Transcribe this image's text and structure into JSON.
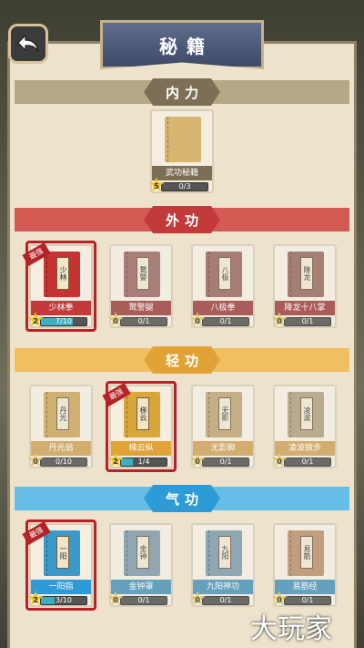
{
  "header": {
    "title": "秘籍"
  },
  "colors": {
    "neigong": "#7d6f55",
    "waigong": "#c23b3a",
    "qinggong": "#e1a236",
    "qigong": "#2e9bd6",
    "progress_fill": "#3bb0c2"
  },
  "categories": [
    {
      "label": "内力",
      "books": [
        {
          "name": "武功秘籍",
          "stars": "5",
          "progress": "0/3",
          "fill": 0.0,
          "best": false,
          "cover": "#d6b670",
          "tag": ""
        }
      ]
    },
    {
      "label": "外功",
      "books": [
        {
          "name": "少林拳",
          "stars": "2",
          "progress": "7/10",
          "fill": 0.7,
          "best": true,
          "best_label": "最强",
          "cover": "#c53431",
          "tag": "少林"
        },
        {
          "name": "鹜警腿",
          "stars": "0",
          "progress": "0/1",
          "fill": 0.0,
          "best": false,
          "cover": "#b06a62",
          "tag": "鹜警"
        },
        {
          "name": "八极拳",
          "stars": "0",
          "progress": "0/1",
          "fill": 0.0,
          "best": false,
          "cover": "#b0655c",
          "tag": "八极"
        },
        {
          "name": "降龙十八掌",
          "stars": "0",
          "progress": "0/1",
          "fill": 0.0,
          "best": false,
          "cover": "#a8695f",
          "tag": "降龙"
        }
      ]
    },
    {
      "label": "轻功",
      "books": [
        {
          "name": "丹光翁",
          "stars": "0",
          "progress": "0/10",
          "fill": 0.0,
          "best": false,
          "cover": "#d9a63a",
          "tag": "丹光"
        },
        {
          "name": "梯云纵",
          "stars": "2",
          "progress": "1/4",
          "fill": 0.25,
          "best": true,
          "best_label": "最强",
          "cover": "#d9a63a",
          "tag": "梯云"
        },
        {
          "name": "无影脚",
          "stars": "0",
          "progress": "0/1",
          "fill": 0.0,
          "best": false,
          "cover": "#c9a45e",
          "tag": "无影"
        },
        {
          "name": "凌波微步",
          "stars": "0",
          "progress": "0/1",
          "fill": 0.0,
          "best": false,
          "cover": "#b8a076",
          "tag": "凌波"
        }
      ]
    },
    {
      "label": "气功",
      "books": [
        {
          "name": "一阳指",
          "stars": "2",
          "progress": "3/10",
          "fill": 0.3,
          "best": true,
          "best_label": "最强",
          "cover": "#3a9ac9",
          "tag": "一阳"
        },
        {
          "name": "金钟罩",
          "stars": "0",
          "progress": "0/1",
          "fill": 0.0,
          "best": false,
          "cover": "#6fa0b8",
          "tag": "金钟"
        },
        {
          "name": "九阳神功",
          "stars": "0",
          "progress": "0/1",
          "fill": 0.0,
          "best": false,
          "cover": "#6f9fbe",
          "tag": "九阳"
        },
        {
          "name": "易筋经",
          "stars": "0",
          "progress": "0/1",
          "fill": 0.0,
          "best": false,
          "cover": "#c98f5a",
          "tag": "易筋"
        }
      ]
    }
  ],
  "watermark": "大玩家"
}
